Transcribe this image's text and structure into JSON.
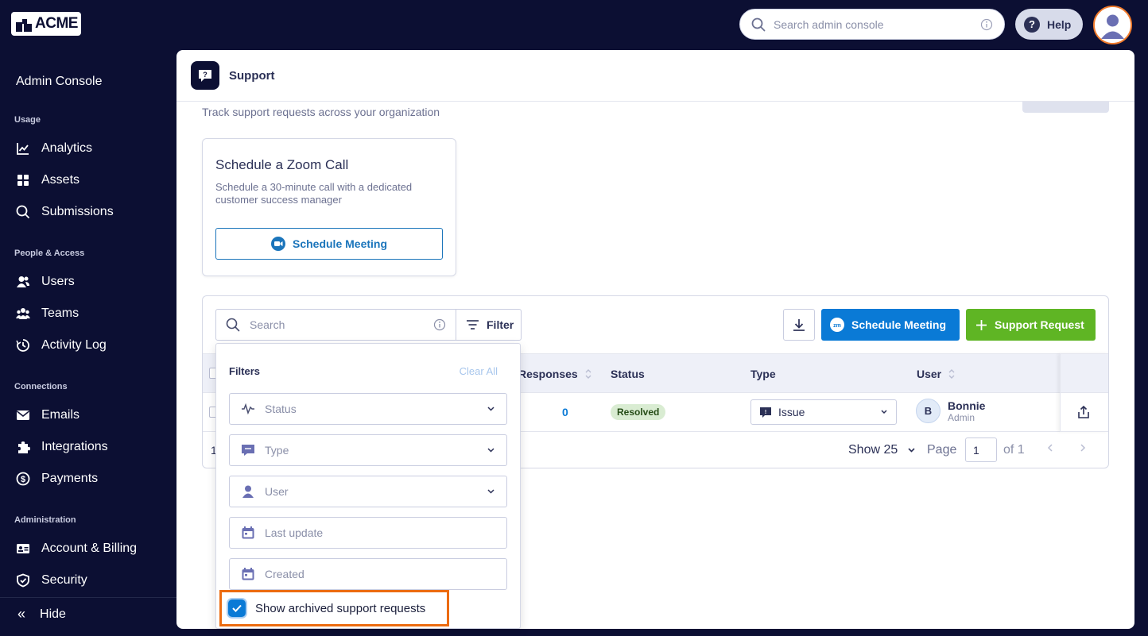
{
  "brand": {
    "name": "ACME"
  },
  "topbar": {
    "search_placeholder": "Search admin console",
    "help_label": "Help"
  },
  "sidebar": {
    "title": "Admin Console",
    "sections": {
      "usage": "Usage",
      "people": "People & Access",
      "connections": "Connections",
      "administration": "Administration"
    },
    "items": {
      "analytics": "Analytics",
      "assets": "Assets",
      "submissions": "Submissions",
      "users": "Users",
      "teams": "Teams",
      "activity_log": "Activity Log",
      "emails": "Emails",
      "integrations": "Integrations",
      "payments": "Payments",
      "account_billing": "Account & Billing",
      "security": "Security"
    },
    "hide_label": "Hide"
  },
  "page": {
    "title": "Support",
    "subtitle": "Track support requests across your organization"
  },
  "zoom_card": {
    "title": "Schedule a Zoom Call",
    "description": "Schedule a 30-minute call with a dedicated customer success manager",
    "button_label": "Schedule Meeting"
  },
  "table": {
    "search_placeholder": "Search",
    "filter_label": "Filter",
    "schedule_meeting_label": "Schedule Meeting",
    "support_request_label": "Support Request",
    "columns": {
      "responses": "Responses",
      "status": "Status",
      "type": "Type",
      "user": "User"
    },
    "rows": [
      {
        "responses": "0",
        "status": "Resolved",
        "type": "Issue",
        "user_initial": "B",
        "user_name": "Bonnie",
        "user_role": "Admin"
      }
    ],
    "pagination": {
      "row_count_fragment": "1",
      "show_label": "Show 25",
      "page_label": "Page",
      "page_value": "1",
      "of_label": "of 1"
    }
  },
  "filters": {
    "title": "Filters",
    "clear_all": "Clear All",
    "status_placeholder": "Status",
    "type_placeholder": "Type",
    "user_placeholder": "User",
    "last_update_placeholder": "Last update",
    "created_placeholder": "Created",
    "show_archived_label": "Show archived support requests",
    "show_archived_checked": true
  },
  "colors": {
    "nav_bg": "#0c0f33",
    "primary_blue": "#0a7ad6",
    "success_green": "#5fb524",
    "highlight_orange": "#ec6b10"
  }
}
